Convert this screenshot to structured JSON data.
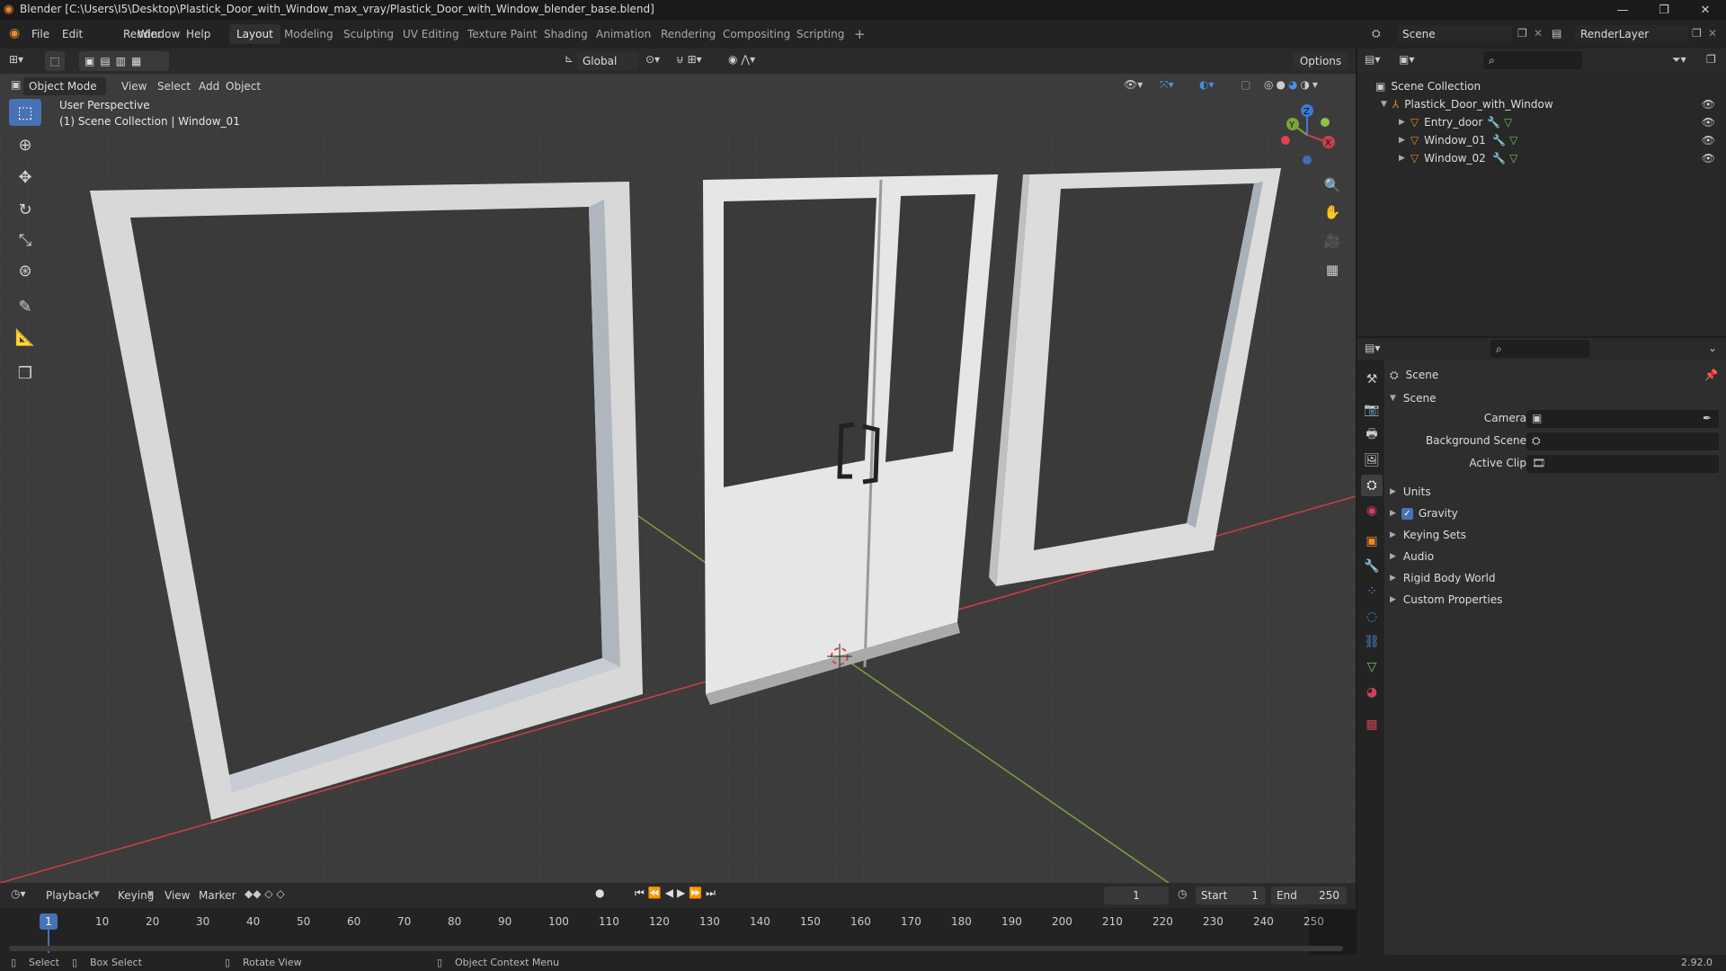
{
  "titlebar": {
    "title": "Blender [C:\\Users\\I5\\Desktop\\Plastick_Door_with_Window_max_vray/Plastick_Door_with_Window_blender_base.blend]"
  },
  "menu": [
    "File",
    "Edit",
    "Render",
    "Window",
    "Help"
  ],
  "workspaces": {
    "active": "Layout",
    "tabs": [
      "Layout",
      "Modeling",
      "Sculpting",
      "UV Editing",
      "Texture Paint",
      "Shading",
      "Animation",
      "Rendering",
      "Compositing",
      "Scripting"
    ],
    "add": "+"
  },
  "scene_selector": {
    "value": "Scene",
    "renderlayer": "RenderLayer"
  },
  "viewport": {
    "mode": "Object Mode",
    "menus": [
      "View",
      "Select",
      "Add",
      "Object"
    ],
    "transform_orientation": "Global",
    "options": "Options",
    "overlay_text_1": "User Perspective",
    "overlay_text_2": "(1) Scene Collection | Window_01",
    "gizmo": {
      "x": "X",
      "y": "Y",
      "z": "Z"
    }
  },
  "outliner": {
    "root": "Scene Collection",
    "collection": "Plastick_Door_with_Window",
    "objects": [
      "Entry_door",
      "Window_01",
      "Window_02"
    ]
  },
  "properties": {
    "header": "Scene",
    "panel": "Scene",
    "fields": {
      "camera": "Camera",
      "background_scene": "Background Scene",
      "active_clip": "Active Clip"
    },
    "sections": [
      "Units",
      "Gravity",
      "Keying Sets",
      "Audio",
      "Rigid Body World",
      "Custom Properties"
    ],
    "gravity_checked": true
  },
  "timeline": {
    "menus": [
      "Playback",
      "Keying",
      "View",
      "Marker"
    ],
    "current_frame": "1",
    "start_label": "Start",
    "start": "1",
    "end_label": "End",
    "end": "250",
    "ticks": [
      "1",
      "10",
      "20",
      "30",
      "40",
      "50",
      "60",
      "70",
      "80",
      "90",
      "100",
      "110",
      "120",
      "130",
      "140",
      "150",
      "160",
      "170",
      "180",
      "190",
      "200",
      "210",
      "220",
      "230",
      "240",
      "250"
    ]
  },
  "statusbar": {
    "select": "Select",
    "box_select": "Box Select",
    "rotate": "Rotate View",
    "context": "Object Context Menu",
    "version": "2.92.0"
  },
  "colors": {
    "accent": "#4772b3",
    "x_axis": "#c8404a",
    "y_axis": "#7da33a",
    "z_axis": "#3d7bd6"
  }
}
